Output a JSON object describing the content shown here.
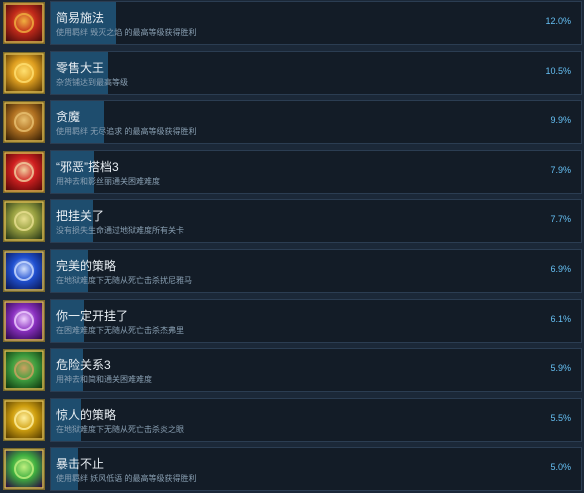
{
  "achievements": [
    {
      "title": "简易施法",
      "desc": "使用羁绊 毁灭之焰 的最高等级获得胜利",
      "percent": "12.0%",
      "fill": 0.12,
      "icon": "fire-demon-icon",
      "colors": [
        "#4a0b0b",
        "#c22a1a",
        "#f0b040"
      ]
    },
    {
      "title": "零售大王",
      "desc": "杂货铺达到最高等级",
      "percent": "10.5%",
      "fill": 0.105,
      "icon": "gold-coins-icon",
      "colors": [
        "#5a3a05",
        "#e0a020",
        "#ffe070"
      ]
    },
    {
      "title": "贪魔",
      "desc": "使用羁绊 无尽追求 的最高等级获得胜利",
      "percent": "9.9%",
      "fill": 0.099,
      "icon": "scroll-icon",
      "colors": [
        "#3a2206",
        "#b07020",
        "#e8c070"
      ]
    },
    {
      "title": "“邪恶”搭档3",
      "desc": "用神去和影丝丽通关困难难度",
      "percent": "7.9%",
      "fill": 0.079,
      "icon": "crossed-weapons-icon",
      "colors": [
        "#5a0808",
        "#d02020",
        "#f0d0a0"
      ]
    },
    {
      "title": "把挂关了",
      "desc": "没有损失生命通过地狱难度所有关卡",
      "percent": "7.7%",
      "fill": 0.077,
      "icon": "wow-badge-icon",
      "colors": [
        "#2a3a18",
        "#98a040",
        "#e8e090"
      ]
    },
    {
      "title": "完美的策略",
      "desc": "在地狱难度下无随从死亡击杀扰尼雅马",
      "percent": "6.9%",
      "fill": 0.069,
      "icon": "cool-badge-icon",
      "colors": [
        "#0a1a5a",
        "#2050d0",
        "#d0e0ff"
      ]
    },
    {
      "title": "你一定开挂了",
      "desc": "在困难难度下无随从死亡击杀杰弗里",
      "percent": "6.1%",
      "fill": 0.061,
      "icon": "excellent-badge-icon",
      "colors": [
        "#300a50",
        "#8a30c0",
        "#f0d0ff"
      ]
    },
    {
      "title": "危险关系3",
      "desc": "用神去和简和通关困难难度",
      "percent": "5.9%",
      "fill": 0.059,
      "icon": "crossed-swords-icon",
      "colors": [
        "#103a10",
        "#40a040",
        "#d0a060"
      ]
    },
    {
      "title": "惊人的策略",
      "desc": "在地狱难度下无随从死亡击杀炎之眼",
      "percent": "5.5%",
      "fill": 0.055,
      "icon": "perfect-badge-icon",
      "colors": [
        "#5a4000",
        "#d0a010",
        "#fff0a0"
      ]
    },
    {
      "title": "暴击不止",
      "desc": "使用羁绊 妖风低语 的最高等级获得胜利",
      "percent": "5.0%",
      "fill": 0.05,
      "icon": "green-clover-icon",
      "colors": [
        "#2a1040",
        "#40b040",
        "#c0f080"
      ]
    }
  ]
}
